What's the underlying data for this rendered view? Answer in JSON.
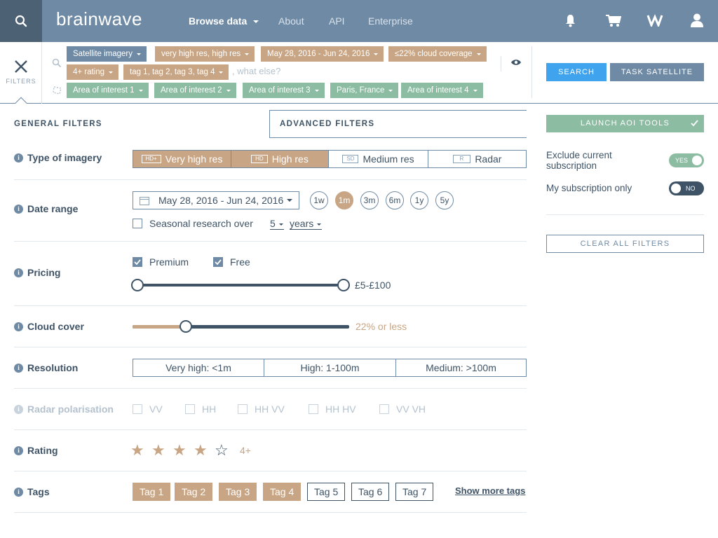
{
  "app": {
    "logo": "brainwave"
  },
  "nav": {
    "browse": "Browse data",
    "about": "About",
    "api": "API",
    "enterprise": "Enterprise"
  },
  "icons": {
    "search": "search-icon",
    "bell": "bell-icon",
    "cart": "cart-icon",
    "brand": "brand-icon",
    "user": "user-icon",
    "close": "close-icon",
    "eye": "eye-icon"
  },
  "filters_label": "FILTERS",
  "chips": {
    "row1": [
      "Satellite imagery",
      "very high res, high res",
      "May 28, 2016 - Jun 24, 2016",
      "≤22% cloud coverage"
    ],
    "row2": [
      "4+ rating",
      "tag 1, tag 2, tag 3, tag 4"
    ],
    "row3": [
      "Area of interest 1",
      "Area of interest 2",
      "Area of interest 3",
      "Paris, France",
      "Area of interest 4"
    ],
    "placeholder": ", what else?"
  },
  "buttons": {
    "search": "SEARCH",
    "task": "TASK SATELLITE",
    "aoi": "LAUNCH AOI TOOLS",
    "clear": "CLEAR ALL FILTERS"
  },
  "tabs": {
    "general": "GENERAL FILTERS",
    "advanced": "ADVANCED FILTERS"
  },
  "rows": {
    "imagery": "Type of imagery",
    "date": "Date range",
    "pricing": "Pricing",
    "cloud": "Cloud cover",
    "resolution": "Resolution",
    "radar": "Radar polarisation",
    "rating": "Rating",
    "tags": "Tags"
  },
  "imagery": [
    {
      "badge": "HD+",
      "label": "Very high res"
    },
    {
      "badge": "HD",
      "label": "High res"
    },
    {
      "badge": "SD",
      "label": "Medium res"
    },
    {
      "badge": "R",
      "label": "Radar"
    }
  ],
  "date": {
    "range": "May 28, 2016 - Jun 24, 2016",
    "quick": [
      "1w",
      "1m",
      "3m",
      "6m",
      "1y",
      "5y"
    ],
    "seasonal_prefix": "Seasonal research over",
    "seasonal_count": "5",
    "seasonal_unit": "years"
  },
  "pricing": {
    "premium": "Premium",
    "free": "Free",
    "range": "£5-£100"
  },
  "cloud": {
    "label": "22% or less",
    "value": 22
  },
  "resolution": [
    "Very high: <1m",
    "High: 1-100m",
    "Medium: >100m"
  ],
  "radar": [
    "VV",
    "HH",
    "HH VV",
    "HH HV",
    "VV VH"
  ],
  "rating": {
    "stars": 4,
    "max": 5,
    "label": "4+"
  },
  "tags": {
    "items": [
      "Tag 1",
      "Tag 2",
      "Tag 3",
      "Tag 4",
      "Tag 5",
      "Tag 6",
      "Tag 7"
    ],
    "selected": 4,
    "more": "Show more tags"
  },
  "side": {
    "exclude": "Exclude current subscription",
    "exclude_toggle": "YES",
    "mysub": "My subscription only",
    "mysub_toggle": "NO"
  },
  "colors": {
    "primary": "#6f8aa4",
    "dark": "#3e5366",
    "tan": "#c8a584",
    "green": "#8cbca2",
    "blue": "#3fa3ee"
  }
}
